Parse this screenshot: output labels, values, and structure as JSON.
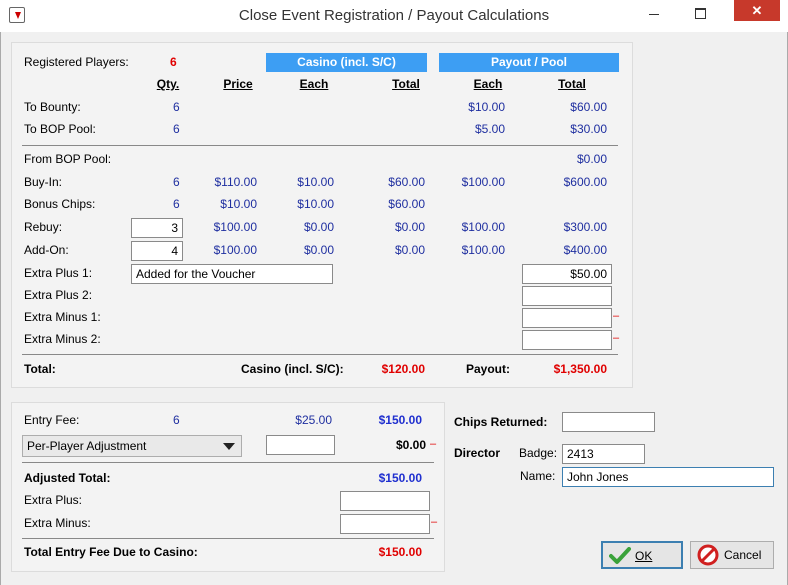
{
  "window": {
    "title": "Close Event Registration / Payout Calculations",
    "close_glyph": "✕"
  },
  "top": {
    "registered_label": "Registered Players:",
    "registered_value": "6",
    "casino_header": "Casino (incl. S/C)",
    "payout_header": "Payout / Pool",
    "col_qty": "Qty.",
    "col_price": "Price",
    "col_casino_each": "Each",
    "col_casino_total": "Total",
    "col_payout_each": "Each",
    "col_payout_total": "Total",
    "to_bounty": {
      "label": "To Bounty:",
      "qty": "6",
      "payout_each": "$10.00",
      "payout_total": "$60.00"
    },
    "to_bop": {
      "label": "To BOP Pool:",
      "qty": "6",
      "payout_each": "$5.00",
      "payout_total": "$30.00"
    },
    "from_bop": {
      "label": "From BOP Pool:",
      "payout_total": "$0.00"
    },
    "buy_in": {
      "label": "Buy-In:",
      "qty": "6",
      "price": "$110.00",
      "casino_each": "$10.00",
      "casino_total": "$60.00",
      "payout_each": "$100.00",
      "payout_total": "$600.00"
    },
    "bonus": {
      "label": "Bonus Chips:",
      "qty": "6",
      "price": "$10.00",
      "casino_each": "$10.00",
      "casino_total": "$60.00"
    },
    "rebuy": {
      "label": "Rebuy:",
      "qty": "3",
      "price": "$100.00",
      "casino_each": "$0.00",
      "casino_total": "$0.00",
      "payout_each": "$100.00",
      "payout_total": "$300.00"
    },
    "addon": {
      "label": "Add-On:",
      "qty": "4",
      "price": "$100.00",
      "casino_each": "$0.00",
      "casino_total": "$0.00",
      "payout_each": "$100.00",
      "payout_total": "$400.00"
    },
    "extra_plus1": {
      "label": "Extra Plus 1:",
      "desc": "Added for the Voucher",
      "amount": "$50.00"
    },
    "extra_plus2": {
      "label": "Extra Plus 2:",
      "amount": ""
    },
    "extra_minus1": {
      "label": "Extra Minus 1:",
      "amount": ""
    },
    "extra_minus2": {
      "label": "Extra Minus 2:",
      "amount": ""
    },
    "minus_mark": "–",
    "total_label": "Total:",
    "casino_total_label": "Casino (incl. S/C):",
    "casino_total_value": "$120.00",
    "payout_total_label": "Payout:",
    "payout_total_value": "$1,350.00"
  },
  "entry": {
    "fee_label": "Entry Fee:",
    "fee_qty": "6",
    "fee_each": "$25.00",
    "fee_total": "$150.00",
    "adjust_select": "Per-Player Adjustment",
    "adjust_input": "",
    "adjust_total": "$0.00",
    "minus_mark": "–",
    "adjusted_label": "Adjusted Total:",
    "adjusted_value": "$150.00",
    "extra_plus_label": "Extra Plus:",
    "extra_plus_value": "",
    "extra_minus_label": "Extra Minus:",
    "extra_minus_value": "",
    "due_label": "Total Entry Fee Due to Casino:",
    "due_value": "$150.00"
  },
  "right": {
    "chips_label": "Chips Returned:",
    "chips_value": "",
    "director_label": "Director",
    "badge_label": "Badge:",
    "badge_value": "2413",
    "name_label": "Name:",
    "name_value": "John Jones"
  },
  "buttons": {
    "ok": "OK",
    "cancel": "Cancel"
  },
  "colors": {
    "accent": "#3d9ef3",
    "red": "#e00000",
    "blue_value": "#1f2fa0",
    "close": "#c7392b"
  }
}
